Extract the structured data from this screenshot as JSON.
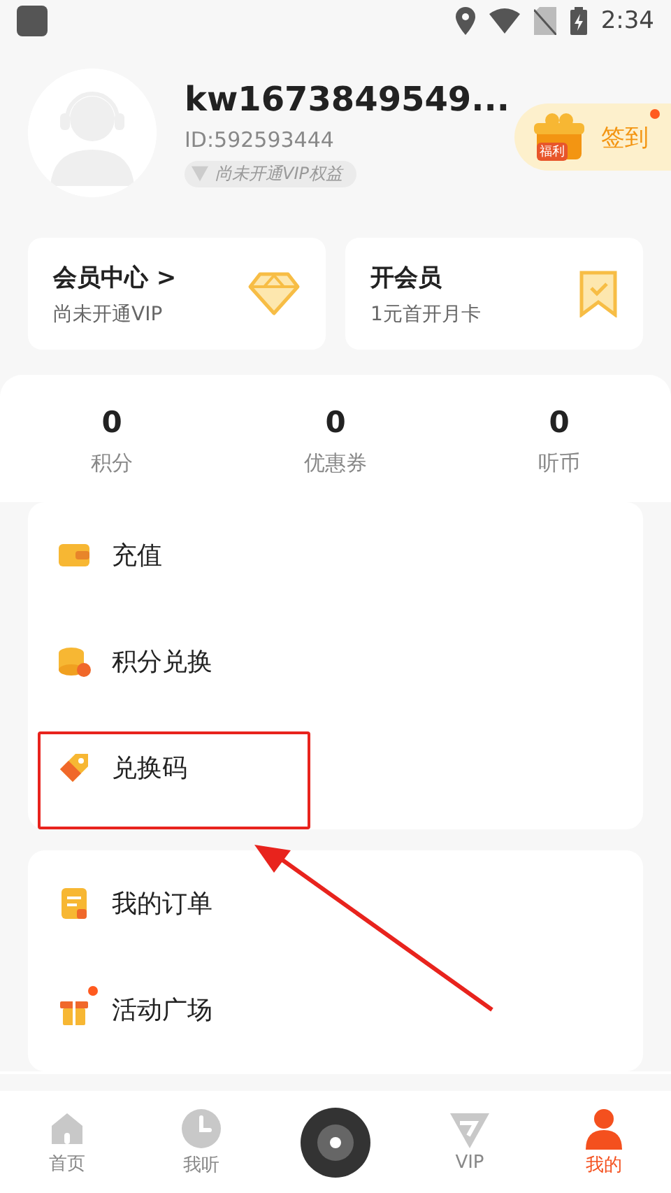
{
  "status_bar": {
    "time": "2:34"
  },
  "profile": {
    "name": "kw1673849549...",
    "id": "ID:592593444",
    "vip_badge": "尚未开通VIP权益",
    "checkin": {
      "tag": "福利",
      "label": "签到",
      "has_notice": true
    }
  },
  "cards": [
    {
      "kind": "diamond",
      "title": "会员中心",
      "chevron": ">",
      "subtitle": "尚未开通VIP"
    },
    {
      "kind": "ribbon",
      "title": "开会员",
      "subtitle": "1元首开月卡"
    }
  ],
  "stats": [
    {
      "value": "0",
      "label": "积分"
    },
    {
      "value": "0",
      "label": "优惠券"
    },
    {
      "value": "0",
      "label": "听币"
    }
  ],
  "menu_groups": [
    [
      {
        "kind": "wallet",
        "label": "充值",
        "highlighted": false,
        "has_notice": false
      },
      {
        "kind": "coins",
        "label": "积分兑换",
        "highlighted": false,
        "has_notice": false
      },
      {
        "kind": "tag",
        "label": "兑换码",
        "highlighted": true,
        "has_notice": false
      }
    ],
    [
      {
        "kind": "order",
        "label": "我的订单",
        "highlighted": false,
        "has_notice": false
      },
      {
        "kind": "gift",
        "label": "活动广场",
        "highlighted": false,
        "has_notice": true
      }
    ]
  ],
  "bottom_nav": [
    {
      "kind": "home",
      "label": "首页",
      "selected": false
    },
    {
      "kind": "clock",
      "label": "我听",
      "selected": false
    },
    {
      "kind": "disc",
      "selected": false
    },
    {
      "kind": "vip",
      "label": "VIP",
      "selected": false
    },
    {
      "kind": "person",
      "label": "我的",
      "selected": true
    }
  ]
}
